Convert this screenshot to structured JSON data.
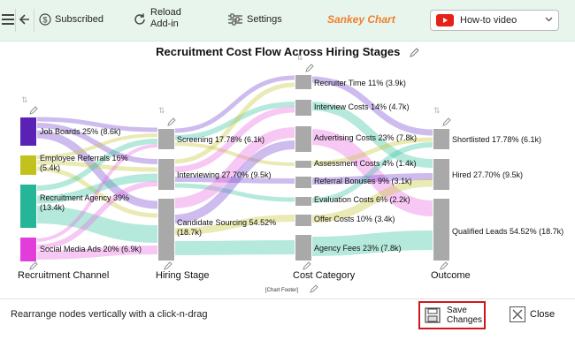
{
  "toolbar": {
    "back_label": "",
    "subscribed_label": "Subscribed",
    "reload_label_1": "Reload",
    "reload_label_2": "Add-in",
    "settings_label": "Settings",
    "app_title": "Sankey Chart",
    "howto_label": "How-to video",
    "colors": {
      "app_title": "#f07f2c",
      "youtube": "#e62117",
      "bg": "#e8f5ec"
    }
  },
  "chart_data": {
    "type": "sankey",
    "title": "Recruitment Cost Flow Across Hiring Stages",
    "footer": "[Chart Footer]",
    "stages": [
      "Recruitment Channel",
      "Hiring Stage",
      "Cost Category",
      "Outcome"
    ],
    "nodes": [
      {
        "id": "job_boards",
        "stage": 0,
        "label": "Job Boards 25% (8.6k)",
        "value": 8.6,
        "color": "#5b21b6"
      },
      {
        "id": "employee_referrals",
        "stage": 0,
        "label": "Employee Referrals 16% (5.4k)",
        "value": 5.4,
        "color": "#c2c21e"
      },
      {
        "id": "recruitment_agency",
        "stage": 0,
        "label": "Recruitment Agency 39% (13.4k)",
        "value": 13.4,
        "color": "#25b597"
      },
      {
        "id": "social_media_ads",
        "stage": 0,
        "label": "Social Media Ads 20% (6.9k)",
        "value": 6.9,
        "color": "#e23ddb"
      },
      {
        "id": "screening",
        "stage": 1,
        "label": "Screening 17.78% (6.1k)",
        "value": 6.1
      },
      {
        "id": "interviewing",
        "stage": 1,
        "label": "Interviewing 27.70% (9.5k)",
        "value": 9.5
      },
      {
        "id": "candidate_sourcing",
        "stage": 1,
        "label": "Candidate Sourcing 54.52% (18.7k)",
        "value": 18.7
      },
      {
        "id": "recruiter_time",
        "stage": 2,
        "label": "Recruiter Time 11% (3.9k)",
        "value": 3.9
      },
      {
        "id": "interview_costs",
        "stage": 2,
        "label": "Interview Costs 14% (4.7k)",
        "value": 4.7
      },
      {
        "id": "advertising_costs",
        "stage": 2,
        "label": "Advertising Costs 23% (7.8k)",
        "value": 7.8
      },
      {
        "id": "assessment_costs",
        "stage": 2,
        "label": "Assessment Costs 4% (1.4k)",
        "value": 1.4
      },
      {
        "id": "referral_bonuses",
        "stage": 2,
        "label": "Referral Bonuses 9% (3.1k)",
        "value": 3.1
      },
      {
        "id": "evaluation_costs",
        "stage": 2,
        "label": "Evaluation Costs 6% (2.2k)",
        "value": 2.2
      },
      {
        "id": "offer_costs",
        "stage": 2,
        "label": "Offer Costs 10% (3.4k)",
        "value": 3.4
      },
      {
        "id": "agency_fees",
        "stage": 2,
        "label": "Agency Fees 23% (7.8k)",
        "value": 7.8
      },
      {
        "id": "shortlisted",
        "stage": 3,
        "label": "Shortlisted 17.78% (6.1k)",
        "value": 6.1
      },
      {
        "id": "hired",
        "stage": 3,
        "label": "Hired 27.70% (9.5k)",
        "value": 9.5
      },
      {
        "id": "qualified_leads",
        "stage": 3,
        "label": "Qualified Leads 54.52% (18.7k)",
        "value": 18.7
      }
    ]
  },
  "footer": {
    "hint": "Rearrange nodes vertically with a click-n-drag",
    "save_label_1": "Save",
    "save_label_2": "Changes",
    "close_label": "Close"
  }
}
